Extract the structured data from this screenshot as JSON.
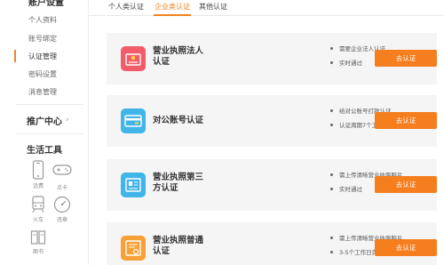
{
  "sidebar": {
    "cut_title": "账户设置",
    "items": [
      {
        "label": "个人资料"
      },
      {
        "label": "账号绑定"
      },
      {
        "label": "认证管理"
      },
      {
        "label": "密码设置"
      },
      {
        "label": "消息管理"
      }
    ],
    "promo_center": "推广中心",
    "life_tools": "生活工具",
    "tools": [
      {
        "label": "话费",
        "icon": "phone-icon"
      },
      {
        "label": "点卡",
        "icon": "gamepad-icon"
      },
      {
        "label": "火车",
        "icon": "train-icon"
      },
      {
        "label": "违章",
        "icon": "speedometer-icon"
      },
      {
        "label": "图书",
        "icon": "book-icon"
      }
    ]
  },
  "tabs": [
    {
      "label": "个人类认证"
    },
    {
      "label": "企业类认证"
    },
    {
      "label": "其他认证"
    }
  ],
  "cards": [
    {
      "title": "营业执照法人认证",
      "icon": "legal-person-icon",
      "color": "#f25b6a",
      "bullets": [
        "需要企业法人认证",
        "实时通过"
      ],
      "button": "去认证"
    },
    {
      "title": "对公账号认证",
      "icon": "bank-card-icon",
      "color": "#41b5e8",
      "bullets": [
        "给对公账号打款认证",
        "认证周期7个工作日"
      ],
      "button": "去认证"
    },
    {
      "title": "营业执照第三方认证",
      "icon": "license-document-icon",
      "color": "#41b5e8",
      "bullets": [
        "需上传清晰营业执照照片",
        "实时通过"
      ],
      "button": "去认证"
    },
    {
      "title": "营业执照普通认证",
      "icon": "certificate-icon",
      "color": "#f7a036",
      "bullets": [
        "需上传清晰营业执照照片",
        "3-5个工作日完成"
      ],
      "button": "去认证"
    }
  ],
  "colors": {
    "accent": "#f0831e",
    "button": "#f57e1f"
  }
}
